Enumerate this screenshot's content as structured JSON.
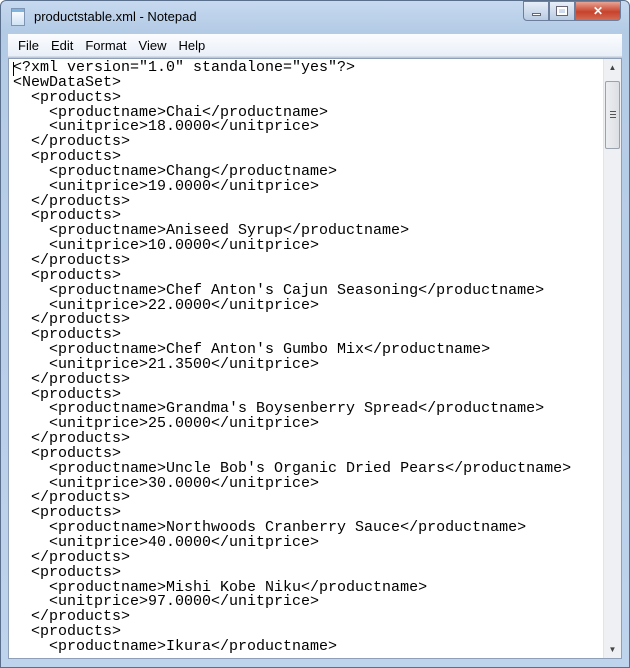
{
  "window": {
    "title": "productstable.xml - Notepad"
  },
  "menu": [
    "File",
    "Edit",
    "Format",
    "View",
    "Help"
  ],
  "lines": [
    "<?xml version=\"1.0\" standalone=\"yes\"?>",
    "<NewDataSet>",
    "  <products>",
    "    <productname>Chai</productname>",
    "    <unitprice>18.0000</unitprice>",
    "  </products>",
    "  <products>",
    "    <productname>Chang</productname>",
    "    <unitprice>19.0000</unitprice>",
    "  </products>",
    "  <products>",
    "    <productname>Aniseed Syrup</productname>",
    "    <unitprice>10.0000</unitprice>",
    "  </products>",
    "  <products>",
    "    <productname>Chef Anton's Cajun Seasoning</productname>",
    "    <unitprice>22.0000</unitprice>",
    "  </products>",
    "  <products>",
    "    <productname>Chef Anton's Gumbo Mix</productname>",
    "    <unitprice>21.3500</unitprice>",
    "  </products>",
    "  <products>",
    "    <productname>Grandma's Boysenberry Spread</productname>",
    "    <unitprice>25.0000</unitprice>",
    "  </products>",
    "  <products>",
    "    <productname>Uncle Bob's Organic Dried Pears</productname>",
    "    <unitprice>30.0000</unitprice>",
    "  </products>",
    "  <products>",
    "    <productname>Northwoods Cranberry Sauce</productname>",
    "    <unitprice>40.0000</unitprice>",
    "  </products>",
    "  <products>",
    "    <productname>Mishi Kobe Niku</productname>",
    "    <unitprice>97.0000</unitprice>",
    "  </products>",
    "  <products>",
    "    <productname>Ikura</productname>"
  ]
}
